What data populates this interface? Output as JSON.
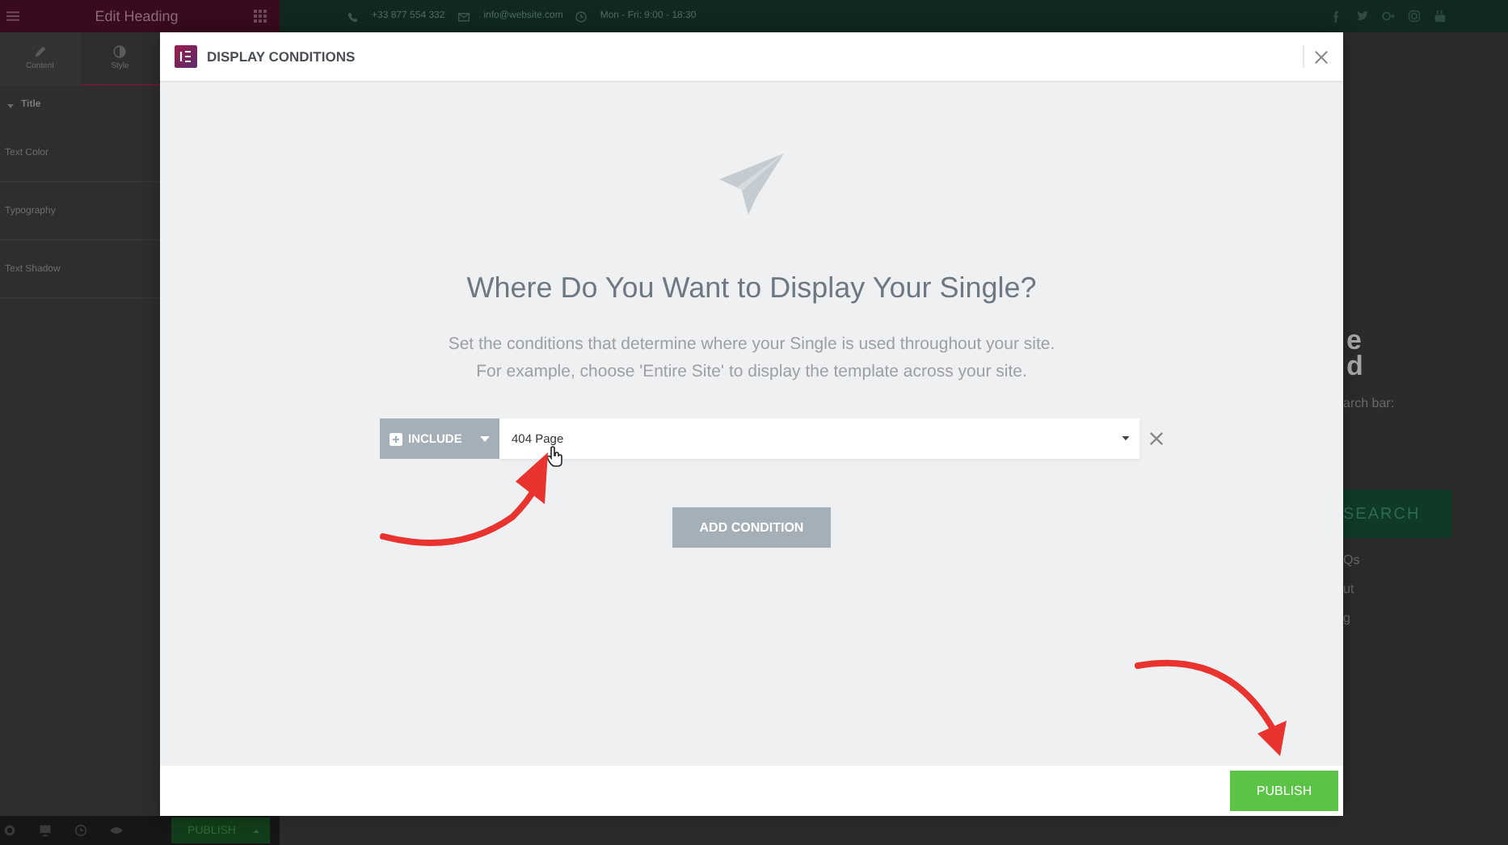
{
  "top_bar": {
    "phone": "+33 877 554 332",
    "email": "info@website.com",
    "hours": "Mon - Fri: 9:00 - 18:30"
  },
  "editor_panel": {
    "title": "Edit Heading",
    "tabs": [
      {
        "label": "Content",
        "selected": false
      },
      {
        "label": "Style",
        "selected": true
      }
    ],
    "section": {
      "label": "Title",
      "expanded": true
    },
    "controls": [
      "Text Color",
      "Typography",
      "Text Shadow"
    ],
    "publish_label": "PUBLISH"
  },
  "page_fragments": {
    "heading_lines": [
      "e",
      "d"
    ],
    "text": "arch bar:",
    "button": "SEARCH",
    "links": [
      "Qs",
      "ut",
      "g"
    ]
  },
  "dialog": {
    "title": "DISPLAY CONDITIONS",
    "heading": "Where Do You Want to Display Your Single?",
    "description_lines": [
      "Set the conditions that determine where your Single is used throughout your site.",
      "For example, choose 'Entire Site' to display the template across your site."
    ],
    "conditions": [
      {
        "type": "INCLUDE",
        "value": "404 Page"
      }
    ],
    "add_button": "ADD CONDITION",
    "publish_button": "PUBLISH"
  }
}
